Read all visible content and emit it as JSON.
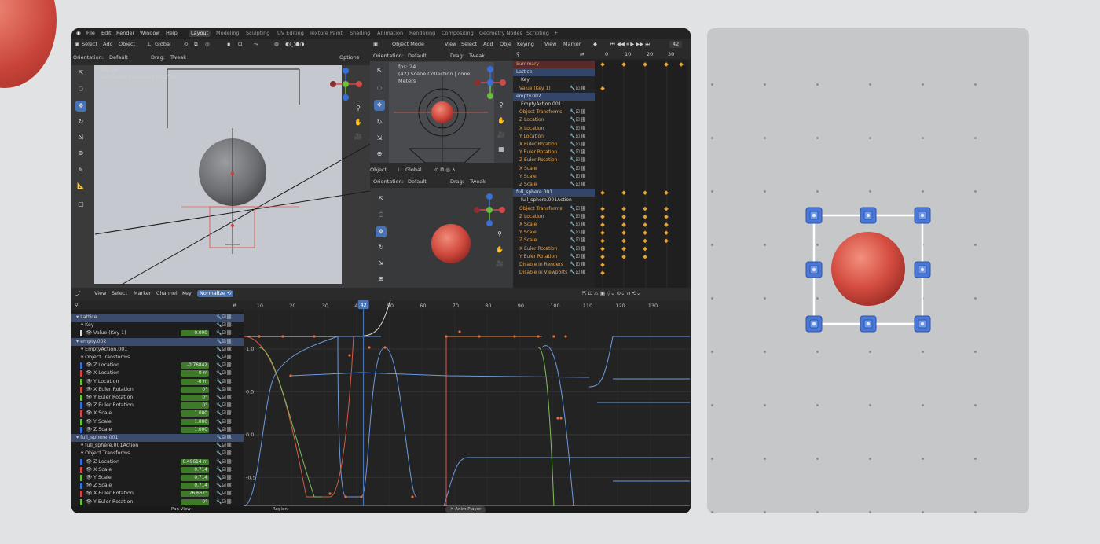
{
  "menu": {
    "items": [
      "File",
      "Edit",
      "Render",
      "Window",
      "Help"
    ],
    "workspaces": [
      "Layout",
      "Modeling",
      "Sculpting",
      "UV Editing",
      "Texture Paint",
      "Shading",
      "Animation",
      "Rendering",
      "Compositing",
      "Geometry Nodes",
      "Scripting"
    ],
    "active_workspace": "Layout",
    "add_tab": "+"
  },
  "viewport_left": {
    "header": [
      "Select",
      "Add",
      "Object"
    ],
    "transform": "Global",
    "orientation_label": "Orientation:",
    "orientation_value": "Default",
    "drag_label": "Drag:",
    "drag_value": "Tweak",
    "options": "Options",
    "fps": "fps: 24",
    "collection": "(42) Scene Collection | Lattice"
  },
  "viewport_top_mid": {
    "mode": "Object Mode",
    "header": [
      "View",
      "Select",
      "Add",
      "Obje"
    ],
    "orientation_label": "Orientation:",
    "orientation_value": "Default",
    "drag_label": "Drag:",
    "drag_value": "Tweak",
    "fps": "fps: 24",
    "collection": "(42) Scene Collection | cone",
    "units": "Meters"
  },
  "viewport_bottom_mid": {
    "header_object": "Object",
    "transform": "Global",
    "orientation_label": "Orientation:",
    "orientation_value": "Default",
    "drag_label": "Drag:",
    "drag_value": "Tweak"
  },
  "dopesheet": {
    "header": [
      "Keying",
      "View",
      "Marker"
    ],
    "frame": "42",
    "frames": [
      "0",
      "10",
      "20",
      "30"
    ],
    "rows": [
      {
        "label": "Summary",
        "kind": "sum"
      },
      {
        "label": "Lattice",
        "kind": "group"
      },
      {
        "label": "Key",
        "kind": "sub"
      },
      {
        "label": "Value (Key 1)",
        "kind": "ch"
      },
      {
        "label": "empty.002",
        "kind": "group"
      },
      {
        "label": "EmptyAction.001",
        "kind": "sub"
      },
      {
        "label": "Object Transforms",
        "kind": "ch"
      },
      {
        "label": "Z Location",
        "kind": "ch"
      },
      {
        "label": "X Location",
        "kind": "ch"
      },
      {
        "label": "Y Location",
        "kind": "ch"
      },
      {
        "label": "X Euler Rotation",
        "kind": "ch"
      },
      {
        "label": "Y Euler Rotation",
        "kind": "ch"
      },
      {
        "label": "Z Euler Rotation",
        "kind": "ch"
      },
      {
        "label": "X Scale",
        "kind": "ch"
      },
      {
        "label": "Y Scale",
        "kind": "ch"
      },
      {
        "label": "Z Scale",
        "kind": "ch"
      },
      {
        "label": "full_sphere.001",
        "kind": "group"
      },
      {
        "label": "full_sphere.001Action",
        "kind": "sub"
      },
      {
        "label": "Object Transforms",
        "kind": "ch"
      },
      {
        "label": "Z Location",
        "kind": "ch"
      },
      {
        "label": "X Scale",
        "kind": "ch"
      },
      {
        "label": "Y Scale",
        "kind": "ch"
      },
      {
        "label": "Z Scale",
        "kind": "ch"
      },
      {
        "label": "X Euler Rotation",
        "kind": "ch"
      },
      {
        "label": "Y Euler Rotation",
        "kind": "ch"
      },
      {
        "label": "Disable in Renders",
        "kind": "ch"
      },
      {
        "label": "Disable in Viewports",
        "kind": "ch"
      }
    ]
  },
  "graph_editor": {
    "header": [
      "View",
      "Select",
      "Marker",
      "Channel",
      "Key"
    ],
    "normalize": "Normalize",
    "current_frame": "42",
    "frames": [
      "10",
      "20",
      "30",
      "40",
      "50",
      "60",
      "70",
      "80",
      "90",
      "100",
      "110",
      "120",
      "130"
    ],
    "y_labels": [
      "1.0",
      "0.5",
      "0.0",
      "-0.5",
      "-1.0"
    ],
    "status": [
      "Pan View",
      "Region"
    ],
    "anim_player": "Anim Player",
    "channels": [
      {
        "label": "Lattice",
        "kind": "group",
        "value": ""
      },
      {
        "label": "Key",
        "kind": "sub",
        "value": ""
      },
      {
        "label": "Value (Key 1)",
        "kind": "ch",
        "value": "0.000",
        "color": "#d9d9d9"
      },
      {
        "label": "empty.002",
        "kind": "group",
        "value": ""
      },
      {
        "label": "EmptyAction.001",
        "kind": "sub",
        "value": ""
      },
      {
        "label": "Object Transforms",
        "kind": "sub",
        "value": ""
      },
      {
        "label": "Z Location",
        "kind": "ch",
        "value": "-0.76842",
        "color": "#3a6fd8"
      },
      {
        "label": "X Location",
        "kind": "ch",
        "value": "0 m",
        "color": "#d04a4a"
      },
      {
        "label": "Y Location",
        "kind": "ch",
        "value": "-0 m",
        "color": "#6bbf3a"
      },
      {
        "label": "X Euler Rotation",
        "kind": "ch",
        "value": "0°",
        "color": "#d04a4a"
      },
      {
        "label": "Y Euler Rotation",
        "kind": "ch",
        "value": "0°",
        "color": "#6bbf3a"
      },
      {
        "label": "Z Euler Rotation",
        "kind": "ch",
        "value": "0°",
        "color": "#3a6fd8"
      },
      {
        "label": "X Scale",
        "kind": "ch",
        "value": "1.000",
        "color": "#d04a4a"
      },
      {
        "label": "Y Scale",
        "kind": "ch",
        "value": "1.000",
        "color": "#6bbf3a"
      },
      {
        "label": "Z Scale",
        "kind": "ch",
        "value": "1.000",
        "color": "#3a6fd8"
      },
      {
        "label": "full_sphere.001",
        "kind": "group",
        "value": ""
      },
      {
        "label": "full_sphere.001Action",
        "kind": "sub",
        "value": ""
      },
      {
        "label": "Object Transforms",
        "kind": "sub",
        "value": ""
      },
      {
        "label": "Z Location",
        "kind": "ch",
        "value": "0.49614 m",
        "color": "#3a6fd8"
      },
      {
        "label": "X Scale",
        "kind": "ch",
        "value": "0.714",
        "color": "#d04a4a"
      },
      {
        "label": "Y Scale",
        "kind": "ch",
        "value": "0.714",
        "color": "#6bbf3a"
      },
      {
        "label": "Z Scale",
        "kind": "ch",
        "value": "0.714",
        "color": "#3a6fd8"
      },
      {
        "label": "X Euler Rotation",
        "kind": "ch",
        "value": "76.667°",
        "color": "#d04a4a"
      },
      {
        "label": "Y Euler Rotation",
        "kind": "ch",
        "value": "0°",
        "color": "#6bbf3a"
      }
    ]
  },
  "colors": {
    "accent": "#4772b3",
    "sphere": "#d9574a",
    "keyframe": "#e8a030",
    "playhead": "#4772b3"
  }
}
